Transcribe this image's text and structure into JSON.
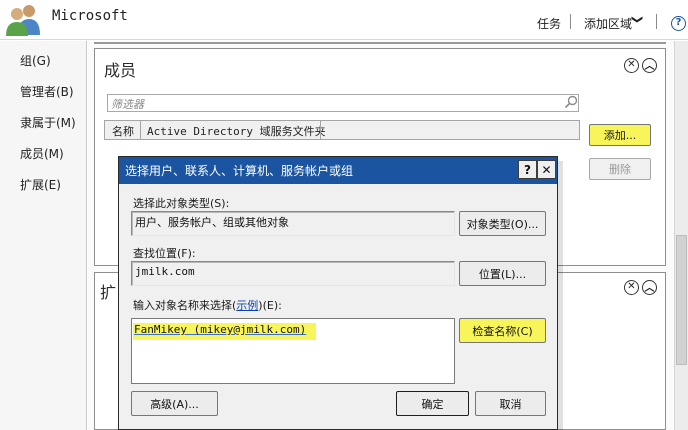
{
  "window": {
    "app_title": "Microsoft",
    "tasks": "任务",
    "add_region": "添加区域",
    "add_region_chevron": "❯",
    "help": "?"
  },
  "sidebar": {
    "items": [
      "组(G)",
      "管理者(B)",
      "隶属于(M)",
      "成员(M)",
      "扩展(E)"
    ]
  },
  "members_panel": {
    "title": "成员",
    "filter_placeholder": "筛选器",
    "columns": [
      "名称",
      "Active Directory 域服务文件夹"
    ],
    "add_label": "添加...",
    "remove_label": "删除",
    "close_glyph": "✕",
    "collapse_glyph": "︿"
  },
  "extensions_panel": {
    "title": "扩"
  },
  "dialog": {
    "title": "选择用户、联系人、计算机、服务帐户或组",
    "help_glyph": "?",
    "close_glyph": "✕",
    "object_type_label": "选择此对象类型(S):",
    "object_type_value": "用户、服务帐户、组或其他对象",
    "object_types_button": "对象类型(O)...",
    "location_label": "查找位置(F):",
    "location_value": "jmilk.com",
    "location_button": "位置(L)...",
    "names_label_pre": "输入对象名称来选择(",
    "names_label_link": "示例",
    "names_label_post": ")(E):",
    "names_value": "FanMikey (mikey@jmilk.com)",
    "check_names_button": "检查名称(C)",
    "advanced_button": "高级(A)...",
    "ok_button": "确定",
    "cancel_button": "取消"
  },
  "colors": {
    "highlight": "#f8f55a",
    "dialog_title_bar": "#1b55a1",
    "link": "#0b3fae"
  }
}
